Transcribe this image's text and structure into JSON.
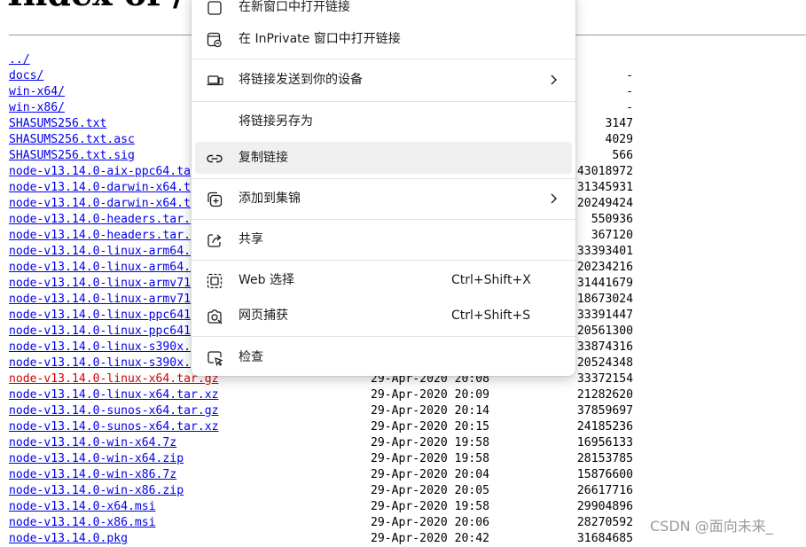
{
  "page": {
    "title": "Index of /"
  },
  "listing": [
    {
      "name": "../",
      "date": "",
      "size": ""
    },
    {
      "name": "docs/",
      "date": "",
      "size": "-"
    },
    {
      "name": "win-x64/",
      "date": "",
      "size": "-"
    },
    {
      "name": "win-x86/",
      "date": "",
      "size": "-"
    },
    {
      "name": "SHASUMS256.txt",
      "date": "",
      "size": "3147"
    },
    {
      "name": "SHASUMS256.txt.asc",
      "date": "",
      "size": "4029"
    },
    {
      "name": "SHASUMS256.txt.sig",
      "date": "",
      "size": "566"
    },
    {
      "name": "node-v13.14.0-aix-ppc64.ta",
      "date": "",
      "size": "43018972"
    },
    {
      "name": "node-v13.14.0-darwin-x64.t",
      "date": "",
      "size": "31345931"
    },
    {
      "name": "node-v13.14.0-darwin-x64.t",
      "date": "",
      "size": "20249424"
    },
    {
      "name": "node-v13.14.0-headers.tar.",
      "date": "",
      "size": "550936"
    },
    {
      "name": "node-v13.14.0-headers.tar.",
      "date": "",
      "size": "367120"
    },
    {
      "name": "node-v13.14.0-linux-arm64.",
      "date": "",
      "size": "33393401"
    },
    {
      "name": "node-v13.14.0-linux-arm64.",
      "date": "",
      "size": "20234216"
    },
    {
      "name": "node-v13.14.0-linux-armv71",
      "date": "",
      "size": "31441679"
    },
    {
      "name": "node-v13.14.0-linux-armv71",
      "date": "",
      "size": "18673024"
    },
    {
      "name": "node-v13.14.0-linux-ppc641",
      "date": "",
      "size": "33391447"
    },
    {
      "name": "node-v13.14.0-linux-ppc641",
      "date": "",
      "size": "20561300"
    },
    {
      "name": "node-v13.14.0-linux-s390x.",
      "date": "",
      "size": "33874316"
    },
    {
      "name": "node-v13.14.0-linux-s390x.",
      "date": "",
      "size": "20524348"
    },
    {
      "name": "node-v13.14.0-linux-x64.tar.gz",
      "date": "29-Apr-2020 20:08",
      "size": "33372154",
      "visited": true
    },
    {
      "name": "node-v13.14.0-linux-x64.tar.xz",
      "date": "29-Apr-2020 20:09",
      "size": "21282620"
    },
    {
      "name": "node-v13.14.0-sunos-x64.tar.gz",
      "date": "29-Apr-2020 20:14",
      "size": "37859697"
    },
    {
      "name": "node-v13.14.0-sunos-x64.tar.xz",
      "date": "29-Apr-2020 20:15",
      "size": "24185236"
    },
    {
      "name": "node-v13.14.0-win-x64.7z",
      "date": "29-Apr-2020 19:58",
      "size": "16956133"
    },
    {
      "name": "node-v13.14.0-win-x64.zip",
      "date": "29-Apr-2020 19:58",
      "size": "28153785"
    },
    {
      "name": "node-v13.14.0-win-x86.7z",
      "date": "29-Apr-2020 20:04",
      "size": "15876600"
    },
    {
      "name": "node-v13.14.0-win-x86.zip",
      "date": "29-Apr-2020 20:05",
      "size": "26617716"
    },
    {
      "name": "node-v13.14.0-x64.msi",
      "date": "29-Apr-2020 19:58",
      "size": "29904896"
    },
    {
      "name": "node-v13.14.0-x86.msi",
      "date": "29-Apr-2020 20:06",
      "size": "28270592"
    },
    {
      "name": "node-v13.14.0.pkg",
      "date": "29-Apr-2020 20:42",
      "size": "31684685"
    }
  ],
  "context_menu": {
    "items": [
      {
        "id": "open-new-window",
        "label": "在新窗口中打开链接",
        "icon": "new-window-icon"
      },
      {
        "id": "open-inprivate",
        "label": "在 InPrivate 窗口中打开链接",
        "icon": "inprivate-window-icon"
      },
      {
        "id": "send-to-devices",
        "label": "将链接发送到你的设备",
        "icon": "devices-icon",
        "submenu": true
      },
      {
        "id": "save-link-as",
        "label": "将链接另存为",
        "icon": ""
      },
      {
        "id": "copy-link",
        "label": "复制链接",
        "icon": "link-icon",
        "hovered": true
      },
      {
        "id": "add-to-collections",
        "label": "添加到集锦",
        "icon": "collections-icon",
        "submenu": true
      },
      {
        "id": "share",
        "label": "共享",
        "icon": "share-icon"
      },
      {
        "id": "web-select",
        "label": "Web 选择",
        "icon": "web-select-icon",
        "shortcut": "Ctrl+Shift+X"
      },
      {
        "id": "web-capture",
        "label": "网页捕获",
        "icon": "web-capture-icon",
        "shortcut": "Ctrl+Shift+S"
      },
      {
        "id": "inspect",
        "label": "检查",
        "icon": "inspect-icon"
      }
    ]
  },
  "watermark": "CSDN @面向未来_",
  "colors": {
    "link": "#0000ee",
    "visited_link": "#d40000",
    "menu_hover": "#f0f0f0"
  }
}
